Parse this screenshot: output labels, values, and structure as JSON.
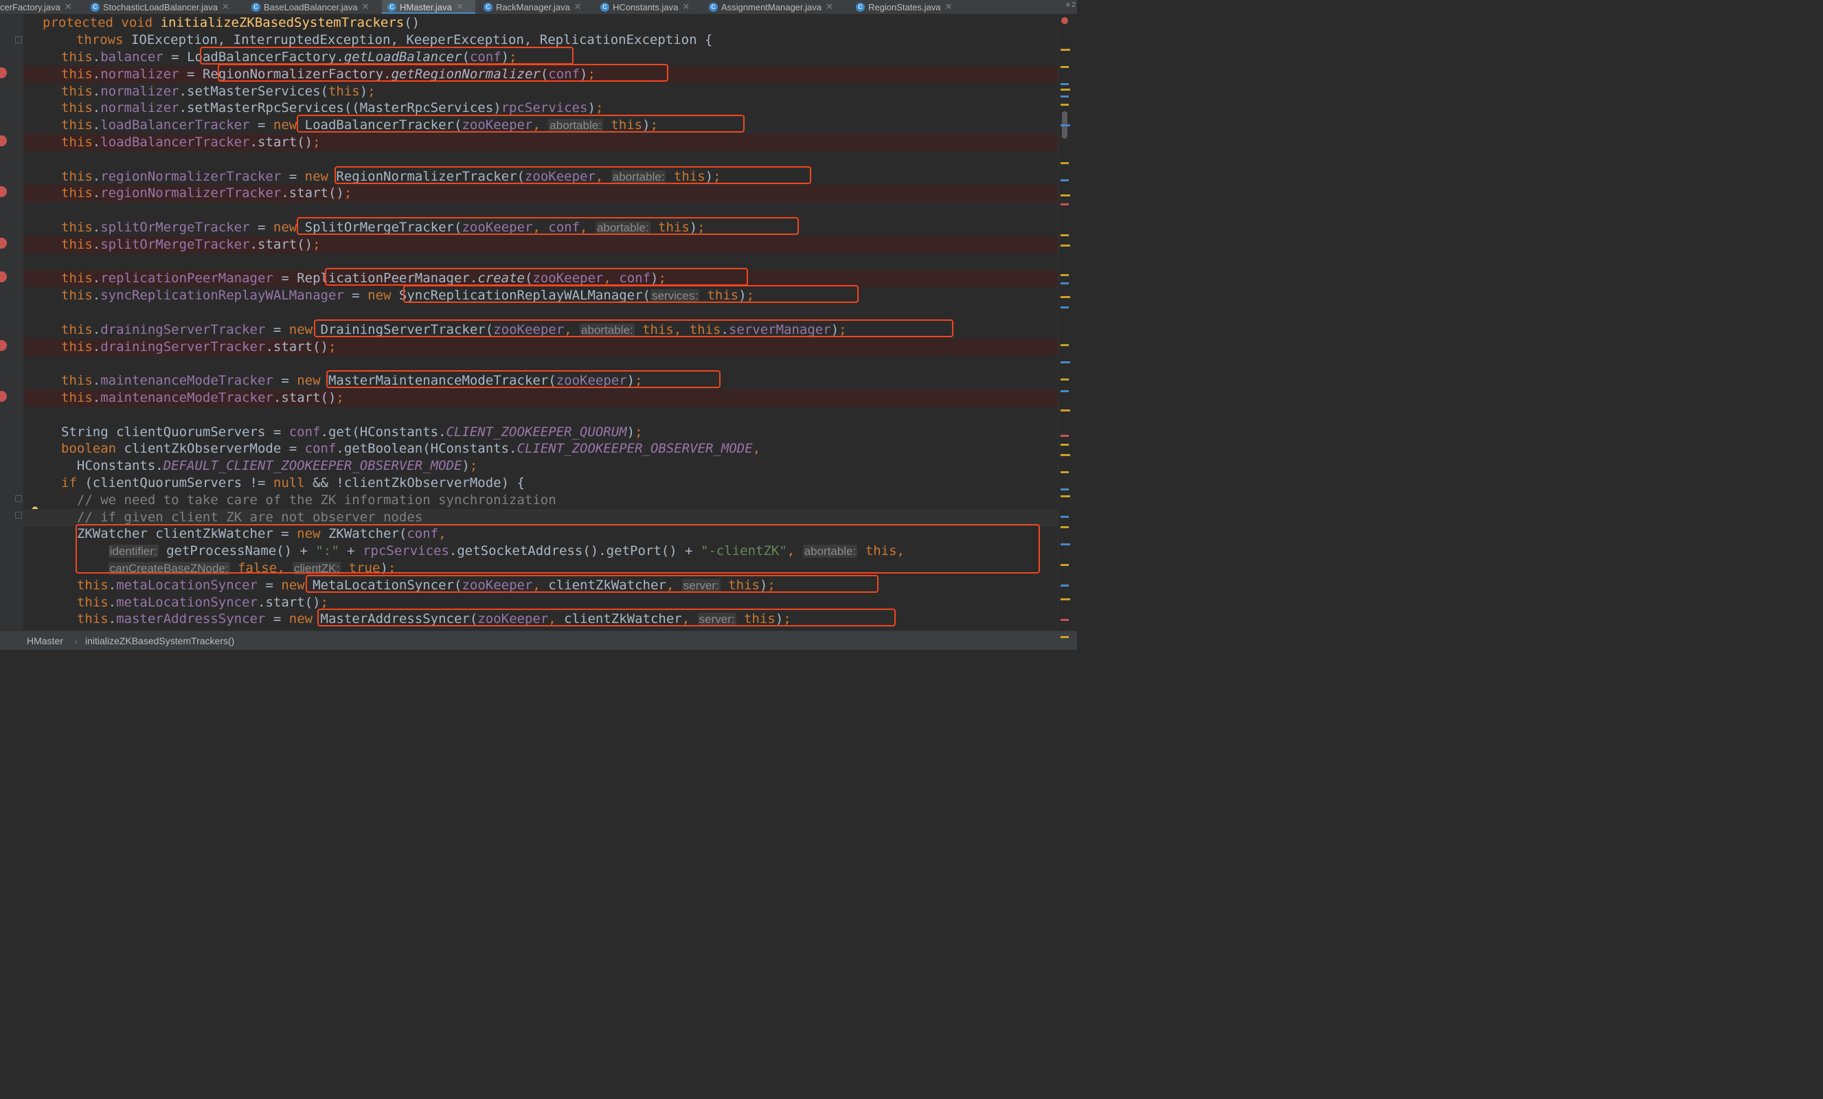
{
  "tabs": [
    {
      "label": "cerFactory.java",
      "icon": "",
      "active": false
    },
    {
      "label": "StochasticLoadBalancer.java",
      "icon": "C",
      "active": false
    },
    {
      "label": "BaseLoadBalancer.java",
      "icon": "C",
      "active": false
    },
    {
      "label": "HMaster.java",
      "icon": "C",
      "active": true
    },
    {
      "label": "RackManager.java",
      "icon": "C",
      "active": false
    },
    {
      "label": "HConstants.java",
      "icon": "C",
      "active": false
    },
    {
      "label": "AssignmentManager.java",
      "icon": "C",
      "active": false
    },
    {
      "label": "RegionStates.java",
      "icon": "C",
      "active": false
    }
  ],
  "tab_overflow": "≡ 2",
  "breadcrumb": {
    "class_name": "HMaster",
    "method_name": "initializeZKBasedSystemTrackers()"
  },
  "colors": {
    "highlight": "#f2461e",
    "breakpoint": "#c75450",
    "keyword": "#cc7832",
    "field": "#9876aa",
    "method": "#ffc66d",
    "string": "#6a8759"
  },
  "code": {
    "l0": [
      [
        "kw",
        "protected void "
      ],
      [
        "meth",
        "initializeZKBasedSystemTrackers"
      ],
      [
        "",
        "()"
      ]
    ],
    "l1": [
      [
        "kw",
        "  throws "
      ],
      [
        "",
        "IOException, InterruptedException, KeeperException, ReplicationException {"
      ]
    ],
    "l2": [
      [
        "kw",
        "this"
      ],
      [
        "",
        "."
      ],
      [
        "fld",
        "balancer"
      ],
      [
        "",
        " = "
      ],
      [
        "",
        "LoadBalancerFactory."
      ],
      [
        "ital",
        "getLoadBalancer"
      ],
      [
        "",
        "("
      ],
      [
        "fld",
        "conf"
      ],
      [
        "",
        ")"
      ],
      [
        "kw",
        ";"
      ]
    ],
    "l3": [
      [
        "kw",
        "this"
      ],
      [
        "",
        "."
      ],
      [
        "fld",
        "normalizer"
      ],
      [
        "",
        " = "
      ],
      [
        "",
        "RegionNormalizerFactory."
      ],
      [
        "ital",
        "getRegionNormalizer"
      ],
      [
        "",
        "("
      ],
      [
        "fld",
        "conf"
      ],
      [
        "",
        ")"
      ],
      [
        "kw",
        ";"
      ]
    ],
    "l4": [
      [
        "kw",
        "this"
      ],
      [
        "",
        "."
      ],
      [
        "fld",
        "normalizer"
      ],
      [
        "",
        ".setMasterServices("
      ],
      [
        "kw",
        "this"
      ],
      [
        "",
        ")"
      ],
      [
        "kw",
        ";"
      ]
    ],
    "l5": [
      [
        "kw",
        "this"
      ],
      [
        "",
        "."
      ],
      [
        "fld",
        "normalizer"
      ],
      [
        "",
        ".setMasterRpcServices((MasterRpcServices)"
      ],
      [
        "fld",
        "rpcServices"
      ],
      [
        "",
        ")"
      ],
      [
        "kw",
        ";"
      ]
    ],
    "l6": [
      [
        "kw",
        "this"
      ],
      [
        "",
        "."
      ],
      [
        "fld",
        "loadBalancerTracker"
      ],
      [
        "",
        " = "
      ],
      [
        "kw",
        "new "
      ],
      [
        "",
        "LoadBalancerTracker("
      ],
      [
        "fld",
        "zooKeeper"
      ],
      [
        "kw",
        ", "
      ],
      [
        "hint",
        "abortable:"
      ],
      [
        "kw",
        " this"
      ],
      [
        "",
        ")"
      ],
      [
        "kw",
        ";"
      ]
    ],
    "l7": [
      [
        "kw",
        "this"
      ],
      [
        "",
        "."
      ],
      [
        "fld",
        "loadBalancerTracker"
      ],
      [
        "",
        ".start()"
      ],
      [
        "kw",
        ";"
      ]
    ],
    "l8": [],
    "l9": [
      [
        "kw",
        "this"
      ],
      [
        "",
        "."
      ],
      [
        "fld",
        "regionNormalizerTracker"
      ],
      [
        "",
        " = "
      ],
      [
        "kw",
        "new "
      ],
      [
        "",
        "RegionNormalizerTracker("
      ],
      [
        "fld",
        "zooKeeper"
      ],
      [
        "kw",
        ", "
      ],
      [
        "hint",
        "abortable:"
      ],
      [
        "kw",
        " this"
      ],
      [
        "",
        ")"
      ],
      [
        "kw",
        ";"
      ]
    ],
    "l10": [
      [
        "kw",
        "this"
      ],
      [
        "",
        "."
      ],
      [
        "fld",
        "regionNormalizerTracker"
      ],
      [
        "",
        ".start()"
      ],
      [
        "kw",
        ";"
      ]
    ],
    "l11": [],
    "l12": [
      [
        "kw",
        "this"
      ],
      [
        "",
        "."
      ],
      [
        "fld",
        "splitOrMergeTracker"
      ],
      [
        "",
        " = "
      ],
      [
        "kw",
        "new "
      ],
      [
        "",
        "SplitOrMergeTracker("
      ],
      [
        "fld",
        "zooKeeper"
      ],
      [
        "kw",
        ", "
      ],
      [
        "fld",
        "conf"
      ],
      [
        "kw",
        ", "
      ],
      [
        "hint",
        "abortable:"
      ],
      [
        "kw",
        " this"
      ],
      [
        "",
        ")"
      ],
      [
        "kw",
        ";"
      ]
    ],
    "l13": [
      [
        "kw",
        "this"
      ],
      [
        "",
        "."
      ],
      [
        "fld",
        "splitOrMergeTracker"
      ],
      [
        "",
        ".start()"
      ],
      [
        "kw",
        ";"
      ]
    ],
    "l14": [],
    "l15": [
      [
        "kw",
        "this"
      ],
      [
        "",
        "."
      ],
      [
        "fld",
        "replicationPeerManager"
      ],
      [
        "",
        " = "
      ],
      [
        "",
        "ReplicationPeerManager."
      ],
      [
        "ital",
        "create"
      ],
      [
        "",
        "("
      ],
      [
        "fld",
        "zooKeeper"
      ],
      [
        "kw",
        ", "
      ],
      [
        "fld",
        "conf"
      ],
      [
        "",
        ")"
      ],
      [
        "kw",
        ";"
      ]
    ],
    "l16": [
      [
        "kw",
        "this"
      ],
      [
        "",
        "."
      ],
      [
        "fld",
        "syncReplicationReplayWALManager"
      ],
      [
        "",
        " = "
      ],
      [
        "kw",
        "new "
      ],
      [
        "",
        "SyncReplicationReplayWALManager("
      ],
      [
        "hint",
        "services:"
      ],
      [
        "kw",
        " this"
      ],
      [
        "",
        ")"
      ],
      [
        "kw",
        ";"
      ]
    ],
    "l17": [],
    "l18": [
      [
        "kw",
        "this"
      ],
      [
        "",
        "."
      ],
      [
        "fld",
        "drainingServerTracker"
      ],
      [
        "",
        " = "
      ],
      [
        "kw",
        "new "
      ],
      [
        "",
        "DrainingServerTracker("
      ],
      [
        "fld",
        "zooKeeper"
      ],
      [
        "kw",
        ", "
      ],
      [
        "hint",
        "abortable:"
      ],
      [
        "kw",
        " this, this"
      ],
      [
        "",
        "."
      ],
      [
        "fld",
        "serverManager"
      ],
      [
        "",
        ")"
      ],
      [
        "kw",
        ";"
      ]
    ],
    "l19": [
      [
        "kw",
        "this"
      ],
      [
        "",
        "."
      ],
      [
        "fld",
        "drainingServerTracker"
      ],
      [
        "",
        ".start()"
      ],
      [
        "kw",
        ";"
      ]
    ],
    "l20": [],
    "l21": [
      [
        "kw",
        "this"
      ],
      [
        "",
        "."
      ],
      [
        "fld",
        "maintenanceModeTracker"
      ],
      [
        "",
        " = "
      ],
      [
        "kw",
        "new "
      ],
      [
        "",
        "MasterMaintenanceModeTracker("
      ],
      [
        "fld",
        "zooKeeper"
      ],
      [
        "",
        ")"
      ],
      [
        "kw",
        ";"
      ]
    ],
    "l22": [
      [
        "kw",
        "this"
      ],
      [
        "",
        "."
      ],
      [
        "fld",
        "maintenanceModeTracker"
      ],
      [
        "",
        ".start()"
      ],
      [
        "kw",
        ";"
      ]
    ],
    "l23": [],
    "l24": [
      [
        "",
        "String clientQuorumServers = "
      ],
      [
        "fld",
        "conf"
      ],
      [
        "",
        ".get(HConstants."
      ],
      [
        "stat",
        "CLIENT_ZOOKEEPER_QUORUM"
      ],
      [
        "",
        ")"
      ],
      [
        "kw",
        ";"
      ]
    ],
    "l25": [
      [
        "kw",
        "boolean "
      ],
      [
        "",
        "clientZkObserverMode = "
      ],
      [
        "fld",
        "conf"
      ],
      [
        "",
        ".getBoolean(HConstants."
      ],
      [
        "stat",
        "CLIENT_ZOOKEEPER_OBSERVER_MODE"
      ],
      [
        "kw",
        ","
      ]
    ],
    "l26": [
      [
        "",
        "  HConstants."
      ],
      [
        "stat",
        "DEFAULT_CLIENT_ZOOKEEPER_OBSERVER_MODE"
      ],
      [
        "",
        ")"
      ],
      [
        "kw",
        ";"
      ]
    ],
    "l27": [
      [
        "kw",
        "if "
      ],
      [
        "",
        "(clientQuorumServers != "
      ],
      [
        "kw",
        "null "
      ],
      [
        "",
        "&& !clientZkObserverMode) {"
      ]
    ],
    "l28": [
      [
        "cmt",
        "  // we need to take care of the ZK information synchronization"
      ]
    ],
    "l29": [
      [
        "cmt",
        "  // if given client ZK are not observer nodes"
      ]
    ],
    "l30": [
      [
        "",
        "  ZKWatcher clientZkWatcher = "
      ],
      [
        "kw",
        "new "
      ],
      [
        "",
        "ZKWatcher("
      ],
      [
        "fld",
        "conf"
      ],
      [
        "kw",
        ","
      ]
    ],
    "l31": [
      [
        "",
        "      "
      ],
      [
        "hint",
        "identifier:"
      ],
      [
        "",
        " getProcessName() + "
      ],
      [
        "str",
        "\":\""
      ],
      [
        "",
        " + "
      ],
      [
        "fld",
        "rpcServices"
      ],
      [
        "",
        ".getSocketAddress().getPort() + "
      ],
      [
        "str",
        "\"-clientZK\""
      ],
      [
        "kw",
        ", "
      ],
      [
        "hint",
        "abortable:"
      ],
      [
        "kw",
        " this,"
      ]
    ],
    "l32": [
      [
        "",
        "      "
      ],
      [
        "hint",
        "canCreateBaseZNode:"
      ],
      [
        "kw",
        " false, "
      ],
      [
        "hint",
        "clientZK:"
      ],
      [
        "kw",
        " true"
      ],
      [
        "",
        ")"
      ],
      [
        "kw",
        ";"
      ]
    ],
    "l33": [
      [
        "kw",
        "  this"
      ],
      [
        "",
        "."
      ],
      [
        "fld",
        "metaLocationSyncer"
      ],
      [
        "",
        " = "
      ],
      [
        "kw",
        "new "
      ],
      [
        "",
        "MetaLocationSyncer("
      ],
      [
        "fld",
        "zooKeeper"
      ],
      [
        "kw",
        ", "
      ],
      [
        "",
        "clientZkWatcher"
      ],
      [
        "kw",
        ", "
      ],
      [
        "hint",
        "server:"
      ],
      [
        "kw",
        " this"
      ],
      [
        "",
        ")"
      ],
      [
        "kw",
        ";"
      ]
    ],
    "l34": [
      [
        "kw",
        "  this"
      ],
      [
        "",
        "."
      ],
      [
        "fld",
        "metaLocationSyncer"
      ],
      [
        "",
        ".start()"
      ],
      [
        "kw",
        ";"
      ]
    ],
    "l35": [
      [
        "kw",
        "  this"
      ],
      [
        "",
        "."
      ],
      [
        "fld",
        "masterAddressSyncer"
      ],
      [
        "",
        " = "
      ],
      [
        "kw",
        "new "
      ],
      [
        "",
        "MasterAddressSyncer("
      ],
      [
        "fld",
        "zooKeeper"
      ],
      [
        "kw",
        ", "
      ],
      [
        "",
        "clientZkWatcher"
      ],
      [
        "kw",
        ", "
      ],
      [
        "hint",
        "server:"
      ],
      [
        "kw",
        " this"
      ],
      [
        "",
        ")"
      ],
      [
        "kw",
        ";"
      ]
    ]
  }
}
